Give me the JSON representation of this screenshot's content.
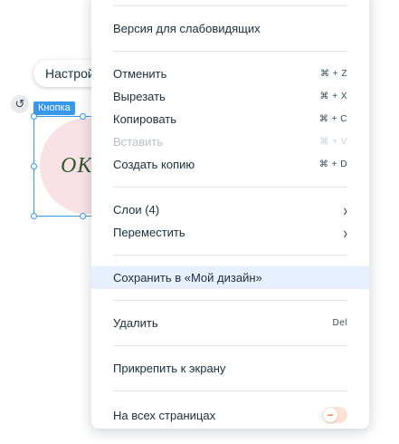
{
  "canvas": {
    "settings_label": "Настройки",
    "element_tag": "Кнопка",
    "button_text": "OK",
    "colors": {
      "selection": "#3899ec",
      "circle": "#f9e1e6",
      "ok_text": "#2f5a2c"
    }
  },
  "menu": {
    "accessibility": "Версия для слабовидящих",
    "edit": [
      {
        "label": "Отменить",
        "shortcut": "⌘ + Z",
        "enabled": true
      },
      {
        "label": "Вырезать",
        "shortcut": "⌘ + X",
        "enabled": true
      },
      {
        "label": "Копировать",
        "shortcut": "⌘ + C",
        "enabled": true
      },
      {
        "label": "Вставить",
        "shortcut": "⌘ + V",
        "enabled": false
      },
      {
        "label": "Создать копию",
        "shortcut": "⌘ + D",
        "enabled": true
      }
    ],
    "layers": "Слои (4)",
    "move": "Переместить",
    "save_to_design": "Сохранить в «Мой дизайн»",
    "delete": "Удалить",
    "delete_shortcut": "Del",
    "pin_to_screen": "Прикрепить к экрану",
    "all_pages": "На всех страницах",
    "all_pages_enabled": false,
    "toggle_symbol": "−",
    "chevron": "›",
    "colors": {
      "highlight": "#e7f0ff",
      "toggle_off": "#fde3d6",
      "toggle_icon": "#f4743b"
    }
  }
}
